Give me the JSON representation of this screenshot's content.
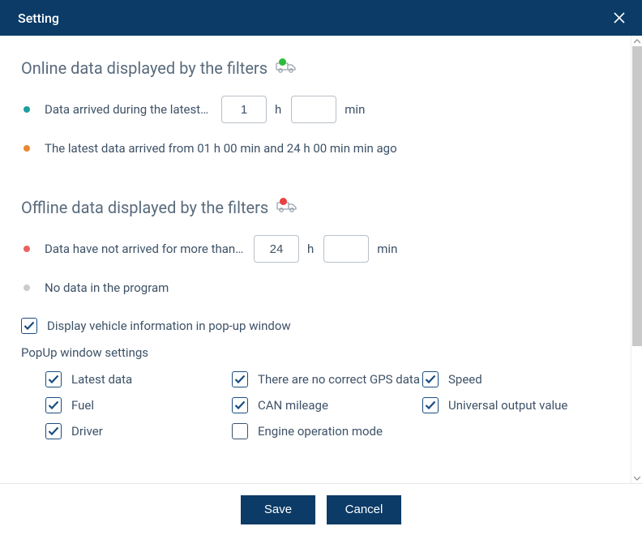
{
  "title": "Setting",
  "online": {
    "heading": "Online data displayed by the filters",
    "row1_label": "Data arrived during the latest",
    "row1_h": "1",
    "row1_min": "",
    "h_unit": "h",
    "min_unit": "min",
    "row2_text": "The latest data arrived from 01 h 00 min and 24 h 00 min min ago"
  },
  "offline": {
    "heading": "Offline data displayed by the filters",
    "row1_label": "Data have not arrived for more than",
    "row1_h": "24",
    "row1_min": "",
    "h_unit": "h",
    "min_unit": "min",
    "row2_text": "No data in the program"
  },
  "display_popup": {
    "label": "Display vehicle information in pop-up window"
  },
  "popup_section": {
    "heading": "PopUp window settings",
    "items": [
      {
        "label": "Latest data",
        "checked": true
      },
      {
        "label": "There are no correct GPS data",
        "checked": true
      },
      {
        "label": "Speed",
        "checked": true
      },
      {
        "label": "Fuel",
        "checked": true
      },
      {
        "label": "CAN mileage",
        "checked": true
      },
      {
        "label": "Universal output value",
        "checked": true
      },
      {
        "label": "Driver",
        "checked": true
      },
      {
        "label": "Engine operation mode",
        "checked": false
      }
    ]
  },
  "footer": {
    "save": "Save",
    "cancel": "Cancel"
  }
}
